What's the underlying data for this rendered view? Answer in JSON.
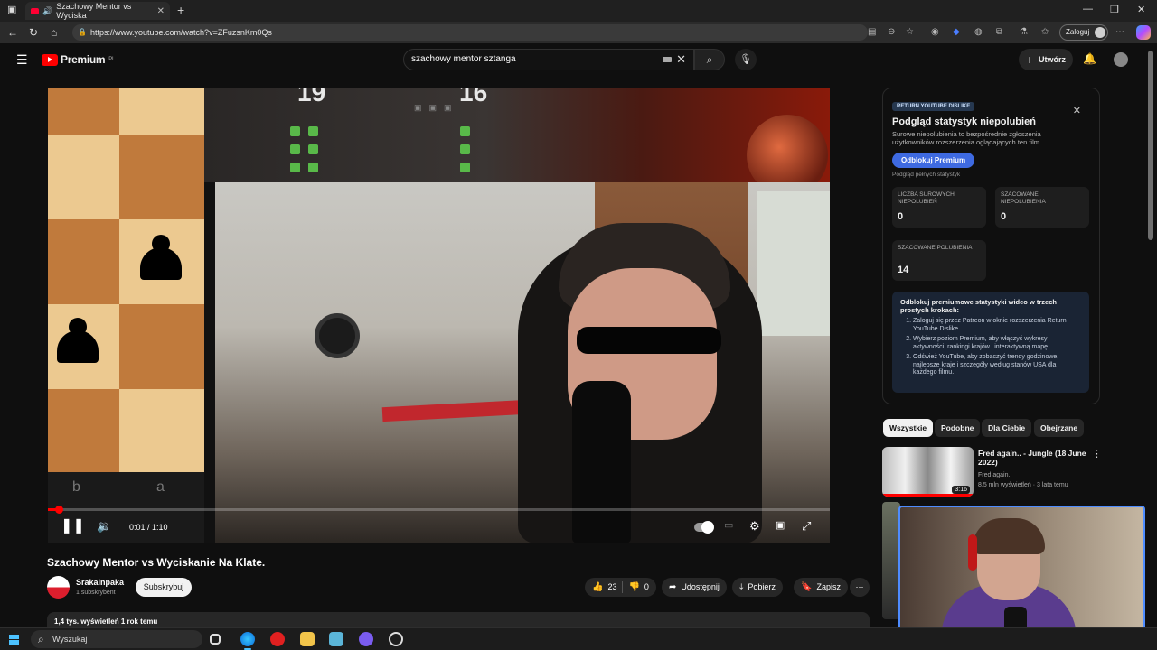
{
  "browser": {
    "tab_title": "Szachowy Mentor vs Wyciska",
    "url": "https://www.youtube.com/watch?v=ZFuzsnKm0Qs",
    "login_label": "Zaloguj"
  },
  "youtube": {
    "brand": "Premium",
    "region": "PL",
    "search_value": "szachowy mentor sztanga",
    "create_label": "Utwórz"
  },
  "player": {
    "board_files": [
      "b",
      "a"
    ],
    "score_left": "19",
    "score_right": "16",
    "time": "0:01 / 1:10",
    "progress_fraction": 0.014
  },
  "video": {
    "title": "Szachowy Mentor vs Wyciskanie Na Klate.",
    "channel": "Srakainpaka",
    "subscribers": "1 subskrybent",
    "subscribe_label": "Subskrybuj",
    "likes": "23",
    "dislikes": "0",
    "share_label": "Udostępnij",
    "download_label": "Pobierz",
    "save_label": "Zapisz",
    "views_line": "1,4 tys. wyświetleń  1 rok temu"
  },
  "ryd": {
    "tag": "RETURN YOUTUBE DISLIKE",
    "title": "Podgląd statystyk niepolubień",
    "description": "Surowe niepolubienia to bezpośrednie zgłoszenia użytkowników rozszerzenia oglądających ten film.",
    "unlock_button": "Odblokuj Premium",
    "preview_note": "Podgląd pełnych statystyk",
    "stat_raw_label": "LICZBA SUROWYCH NIEPOLUBIEŃ",
    "stat_raw_value": "0",
    "stat_est_dislikes_label": "SZACOWANE NIEPOLUBIENIA",
    "stat_est_dislikes_value": "0",
    "stat_est_likes_label": "SZACOWANE POLUBIENIA",
    "stat_est_likes_value": "14",
    "steps_heading": "Odblokuj premiumowe statystyki wideo w trzech prostych krokach:",
    "steps": [
      "Zaloguj się przez Patreon w oknie rozszerzenia Return YouTube Dislike.",
      "Wybierz poziom Premium, aby włączyć wykresy aktywności, rankingi krajów i interaktywną mapę.",
      "Odśwież YouTube, aby zobaczyć trendy godzinowe, najlepsze kraje i szczegóły według stanów USA dla każdego filmu."
    ]
  },
  "chips": [
    "Wszystkie",
    "Podobne",
    "Dla Ciebie",
    "Obejrzane"
  ],
  "related": {
    "title": "Fred again.. - Jungle (18 June 2022)",
    "channel": "Fred again..",
    "meta": "8,5 mln wyświetleń · 3 lata temu",
    "duration": "3:16"
  },
  "taskbar": {
    "search_label": "Wyszukaj"
  },
  "colors": {
    "yt_red": "#ff0000",
    "ryd_button": "#3e6ae1",
    "webcam_border": "#4e8cff"
  },
  "icons": [
    "menu-icon",
    "search-icon",
    "mic-icon",
    "bell-icon",
    "play-pause-icon",
    "volume-icon",
    "settings-icon",
    "fullscreen-icon",
    "like-icon",
    "dislike-icon",
    "share-icon",
    "download-icon",
    "save-icon",
    "more-icon",
    "windows-logo-icon"
  ]
}
